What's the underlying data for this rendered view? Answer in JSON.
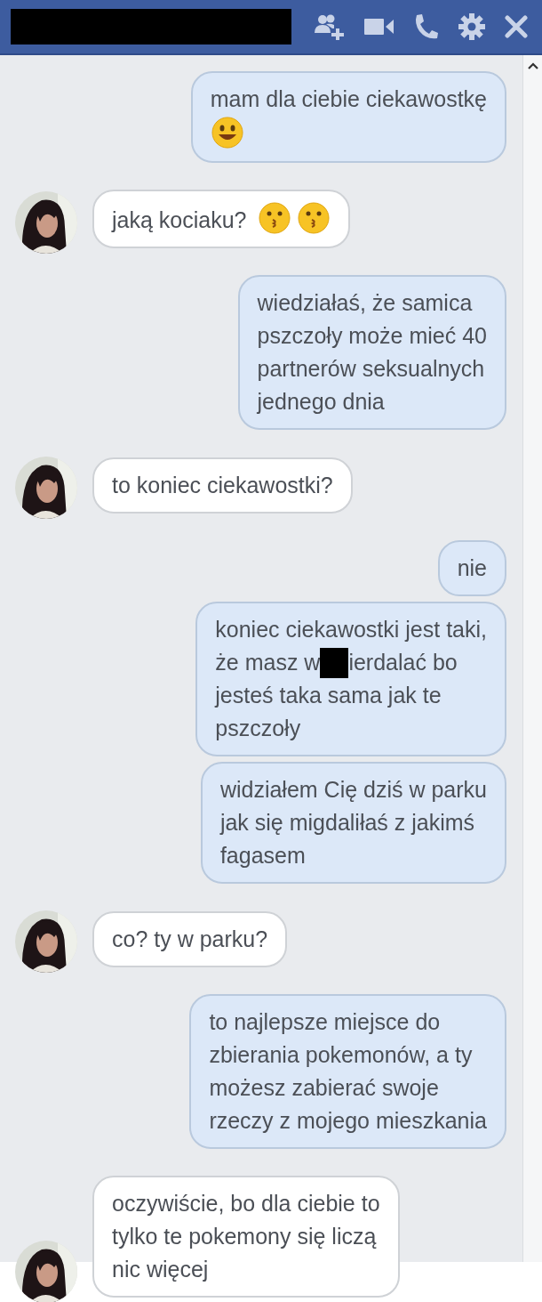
{
  "header": {
    "title_redacted": true
  },
  "messages": [
    {
      "outgoing": true,
      "text": "mam dla ciebie ciekawostkę",
      "emojis": [
        {
          "kind": "smile"
        }
      ],
      "emoji_break": true
    },
    {
      "outgoing": false,
      "text": "jaką kociaku?",
      "emojis": [
        {
          "kind": "kiss"
        },
        {
          "kind": "kiss"
        }
      ],
      "emoji_break": false
    },
    {
      "outgoing": true,
      "text": "wiedziałaś, że samica\npszczoły może mieć 40\npartnerów seksualnych\njednego dnia"
    },
    {
      "outgoing": false,
      "text": "to koniec ciekawostki?"
    },
    {
      "outgoing": true,
      "text": "nie"
    },
    {
      "outgoing": true,
      "text_top": "koniec ciekawostki jest taki,",
      "redacted_line": [
        "że masz w",
        "ierdalać bo"
      ],
      "text_bottom": "jesteś taka sama jak te\npszczoły"
    },
    {
      "outgoing": true,
      "text": "widziałem Cię dziś w parku\njak się migdaliłaś z jakimś\nfagasem"
    },
    {
      "outgoing": false,
      "text": "co? ty w parku?"
    },
    {
      "outgoing": true,
      "text": "to najlepsze miejsce do\nzbierania pokemonów, a ty\nmożesz zabierać swoje\nrzeczy z mojego mieszkania"
    },
    {
      "outgoing": false,
      "text": "oczywiście, bo dla ciebie to\ntylko te pokemony się liczą\nnic więcej"
    }
  ]
}
